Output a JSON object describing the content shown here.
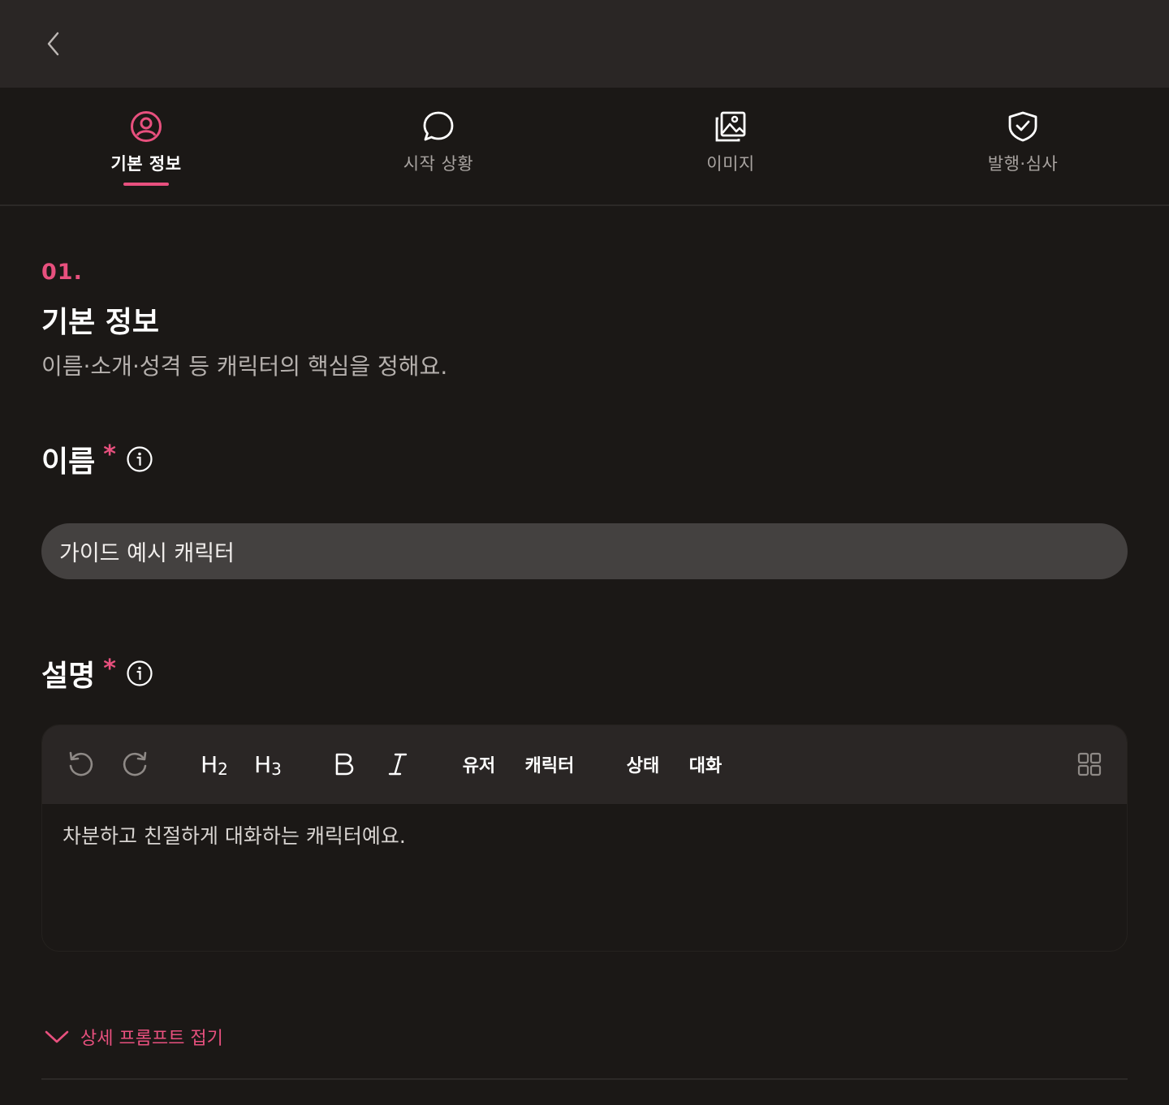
{
  "tabs": [
    {
      "label": "기본 정보",
      "icon": "user-circle-icon",
      "active": true
    },
    {
      "label": "시작 상황",
      "icon": "chat-bubble-icon",
      "active": false
    },
    {
      "label": "이미지",
      "icon": "image-gallery-icon",
      "active": false
    },
    {
      "label": "발행·심사",
      "icon": "shield-check-icon",
      "active": false
    }
  ],
  "section": {
    "number": "01.",
    "title": "기본 정보",
    "description": "이름·소개·성격 등 캐릭터의 핵심을 정해요."
  },
  "name_field": {
    "label": "이름",
    "required_mark": "*",
    "value": "가이드 예시 캐릭터"
  },
  "description_field": {
    "label": "설명",
    "required_mark": "*",
    "content": "차분하고 친절하게 대화하는 캐릭터예요."
  },
  "toolbar": {
    "h2": "H",
    "h2_sub": "2",
    "h3": "H",
    "h3_sub": "3",
    "user": "유저",
    "character": "캐릭터",
    "status": "상태",
    "dialogue": "대화"
  },
  "collapse": {
    "label": "상세 프롬프트 접기"
  },
  "colors": {
    "accent": "#e8507e",
    "background": "#1b1816",
    "topbar": "#2a2625",
    "input": "#444140"
  }
}
